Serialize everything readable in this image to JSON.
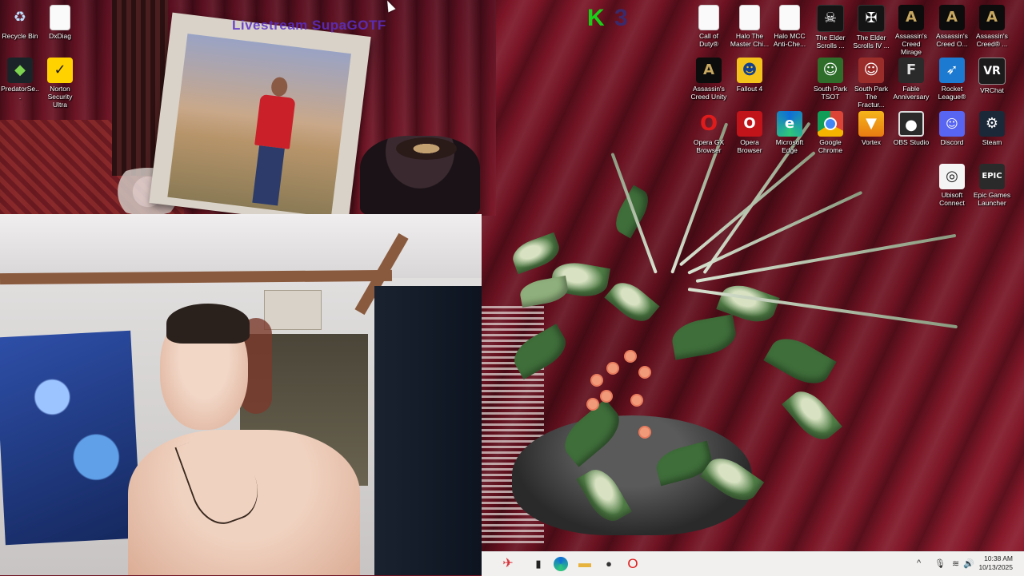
{
  "overlay": {
    "watermark": "Livestream SupaGOTF",
    "logo_left": "K",
    "logo_right": "3"
  },
  "desktop_icons": [
    {
      "label": "Recycle Bin",
      "icon": "recycle-bin-icon",
      "glyph": "♻"
    },
    {
      "label": "DxDiag",
      "icon": "document-icon",
      "glyph": ""
    },
    {
      "label": "PredatorSe...",
      "icon": "predator-sense-icon",
      "glyph": "◆"
    },
    {
      "label": "Norton Security Ultra",
      "icon": "norton-icon",
      "glyph": "✓"
    },
    {
      "label": "Call of Duty®",
      "icon": "document-icon",
      "glyph": ""
    },
    {
      "label": "Halo The Master Chi...",
      "icon": "document-icon",
      "glyph": ""
    },
    {
      "label": "Halo MCC Anti-Che...",
      "icon": "document-icon",
      "glyph": ""
    },
    {
      "label": "The Elder Scrolls ...",
      "icon": "skyrim-icon",
      "glyph": "☠"
    },
    {
      "label": "The Elder Scrolls IV ...",
      "icon": "oblivion-icon",
      "glyph": "✠"
    },
    {
      "label": "Assassin's Creed Mirage",
      "icon": "assassins-creed-icon",
      "glyph": "A"
    },
    {
      "label": "Assassin's Creed O...",
      "icon": "assassins-creed-icon",
      "glyph": "A"
    },
    {
      "label": "Assassin's Creed® ...",
      "icon": "assassins-creed-icon",
      "glyph": "A"
    },
    {
      "label": "Assassin's Creed Unity",
      "icon": "assassins-creed-icon",
      "glyph": "A"
    },
    {
      "label": "Fallout 4",
      "icon": "fallout-icon",
      "glyph": "☻"
    },
    {
      "label": "South Park TSOT",
      "icon": "south-park-icon",
      "glyph": "☺"
    },
    {
      "label": "South Park The Fractur...",
      "icon": "south-park-icon",
      "glyph": "☺"
    },
    {
      "label": "Fable Anniversary",
      "icon": "fable-icon",
      "glyph": "F"
    },
    {
      "label": "Rocket League®",
      "icon": "rocket-league-icon",
      "glyph": "➶"
    },
    {
      "label": "VRChat",
      "icon": "vrchat-icon",
      "glyph": "VR"
    },
    {
      "label": "Opera GX Browser",
      "icon": "opera-gx-icon",
      "glyph": "O"
    },
    {
      "label": "Opera Browser",
      "icon": "opera-icon",
      "glyph": "O"
    },
    {
      "label": "Microsoft Edge",
      "icon": "edge-icon",
      "glyph": "e"
    },
    {
      "label": "Google Chrome",
      "icon": "chrome-icon",
      "glyph": ""
    },
    {
      "label": "Vortex",
      "icon": "vortex-icon",
      "glyph": "▼"
    },
    {
      "label": "OBS Studio",
      "icon": "obs-icon",
      "glyph": "●"
    },
    {
      "label": "Discord",
      "icon": "discord-icon",
      "glyph": "☺"
    },
    {
      "label": "Steam",
      "icon": "steam-icon",
      "glyph": "⚙"
    },
    {
      "label": "Ubisoft Connect",
      "icon": "ubisoft-icon",
      "glyph": "◎"
    },
    {
      "label": "Epic Games Launcher",
      "icon": "epic-games-icon",
      "glyph": "EPIC"
    }
  ],
  "taskbar": {
    "start_glyph": "✈",
    "task_view_glyph": "▮",
    "folder_glyph": "▬",
    "game_glyph": "●",
    "opera_glyph": "O",
    "tray_chevron": "^",
    "mic_glyph": "🎙",
    "wifi_glyph": "≋",
    "volume_glyph": "🔊",
    "time": "10:38 AM",
    "date": "10/13/2025"
  },
  "colors": {
    "wallpaper": "#7a1526",
    "taskbar": "#f1f0ee",
    "logo_green": "#18d018",
    "watermark_purple": "#5b2fc8"
  }
}
